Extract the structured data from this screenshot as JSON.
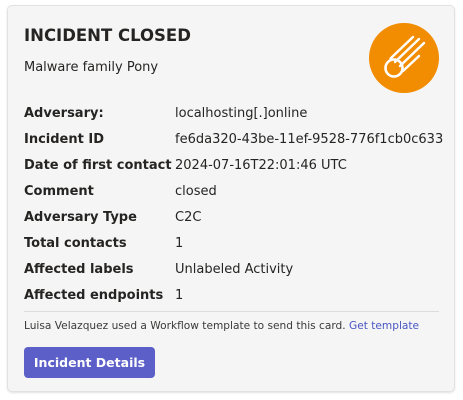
{
  "card": {
    "title": "INCIDENT CLOSED",
    "subtitle": "Malware family Pony",
    "badge_icon": "meteor-icon",
    "badge_color": "#f28c00",
    "facts": [
      {
        "label": "Adversary:",
        "value": "localhosting[.]online"
      },
      {
        "label": "Incident ID",
        "value": "fe6da320-43be-11ef-9528-776f1cb0c633"
      },
      {
        "label": "Date of first contact",
        "value": "2024-07-16T22:01:46 UTC"
      },
      {
        "label": "Comment",
        "value": "closed"
      },
      {
        "label": "Adversary Type",
        "value": "C2C"
      },
      {
        "label": "Total contacts",
        "value": "1"
      },
      {
        "label": "Affected labels",
        "value": "Unlabeled Activity"
      },
      {
        "label": "Affected endpoints",
        "value": "1"
      }
    ],
    "footer_text": "Luisa Velazquez used a Workflow template to send this card.",
    "footer_link": "Get template",
    "button_label": "Incident Details",
    "button_color": "#5b5fc7",
    "link_color": "#4a56c4"
  }
}
